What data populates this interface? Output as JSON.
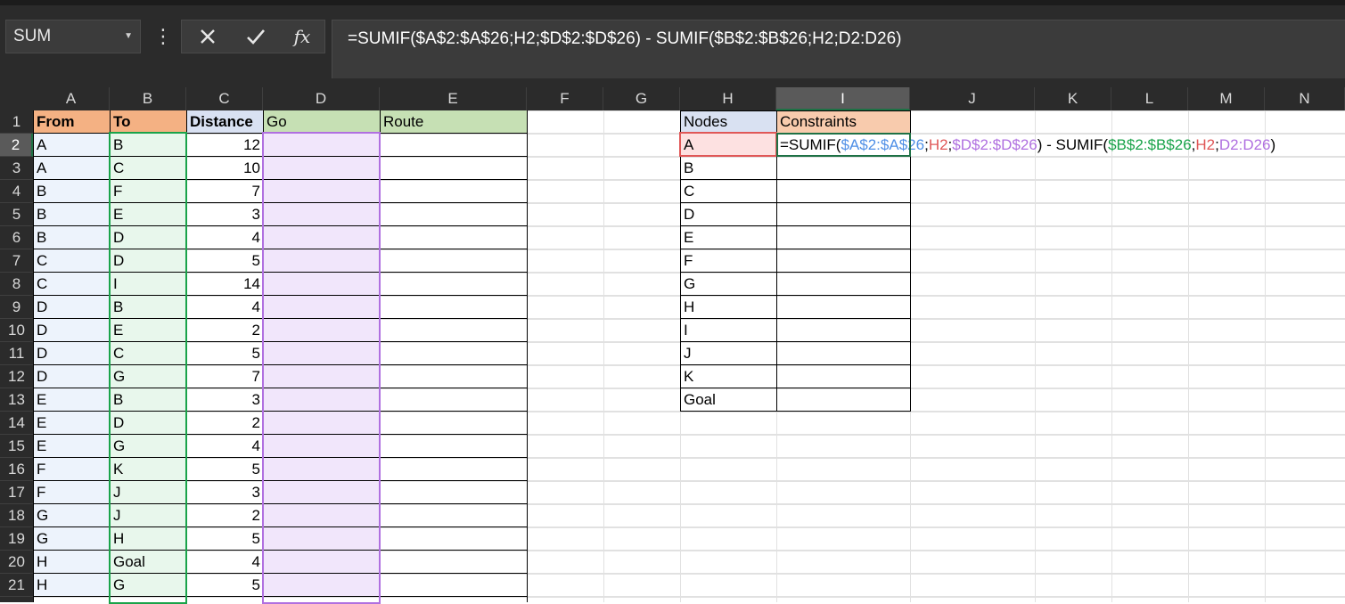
{
  "name_box": {
    "value": "SUM",
    "dropdown_icon": "chevron-down-icon"
  },
  "formula_buttons": {
    "cancel_icon": "cancel-x-icon",
    "enter_icon": "checkmark-icon",
    "fx_label": "fx"
  },
  "formula_bar": {
    "text": "=SUMIF($A$2:$A$26;H2;$D$2:$D$26) - SUMIF($B$2:$B$26;H2;D2:D26)"
  },
  "columns": [
    "A",
    "B",
    "C",
    "D",
    "E",
    "F",
    "G",
    "H",
    "I",
    "J",
    "K",
    "L",
    "M",
    "N"
  ],
  "selected_column": "I",
  "rows": [
    "1",
    "2",
    "3",
    "4",
    "5",
    "6",
    "7",
    "8",
    "9",
    "10",
    "11",
    "12",
    "13",
    "14",
    "15",
    "16",
    "17",
    "18",
    "19",
    "20",
    "21"
  ],
  "selected_row": "2",
  "table_headers": {
    "from": "From",
    "to": "To",
    "distance": "Distance",
    "go": "Go",
    "route": "Route"
  },
  "edges": [
    {
      "from": "A",
      "to": "B",
      "distance": "12"
    },
    {
      "from": "A",
      "to": "C",
      "distance": "10"
    },
    {
      "from": "B",
      "to": "F",
      "distance": "7"
    },
    {
      "from": "B",
      "to": "E",
      "distance": "3"
    },
    {
      "from": "B",
      "to": "D",
      "distance": "4"
    },
    {
      "from": "C",
      "to": "D",
      "distance": "5"
    },
    {
      "from": "C",
      "to": "I",
      "distance": "14"
    },
    {
      "from": "D",
      "to": "B",
      "distance": "4"
    },
    {
      "from": "D",
      "to": "E",
      "distance": "2"
    },
    {
      "from": "D",
      "to": "C",
      "distance": "5"
    },
    {
      "from": "D",
      "to": "G",
      "distance": "7"
    },
    {
      "from": "E",
      "to": "B",
      "distance": "3"
    },
    {
      "from": "E",
      "to": "D",
      "distance": "2"
    },
    {
      "from": "E",
      "to": "G",
      "distance": "4"
    },
    {
      "from": "F",
      "to": "K",
      "distance": "5"
    },
    {
      "from": "F",
      "to": "J",
      "distance": "3"
    },
    {
      "from": "G",
      "to": "J",
      "distance": "2"
    },
    {
      "from": "G",
      "to": "H",
      "distance": "5"
    },
    {
      "from": "H",
      "to": "Goal",
      "distance": "4"
    },
    {
      "from": "H",
      "to": "G",
      "distance": "5"
    }
  ],
  "nodes_table": {
    "nodes_header": "Nodes",
    "constraints_header": "Constraints",
    "nodes": [
      "A",
      "B",
      "C",
      "D",
      "E",
      "F",
      "G",
      "H",
      "I",
      "J",
      "K",
      "Goal"
    ]
  },
  "editing_cell": {
    "parts": [
      {
        "text": "=SUMIF(",
        "color": "#000000"
      },
      {
        "text": "$A$2:$A$26",
        "color": "#4f8fe6"
      },
      {
        "text": ";",
        "color": "#000000"
      },
      {
        "text": "H2",
        "color": "#e05757"
      },
      {
        "text": ";",
        "color": "#000000"
      },
      {
        "text": "$D$2:$D$26",
        "color": "#b070e0"
      },
      {
        "text": ") - SUMIF(",
        "color": "#000000"
      },
      {
        "text": "$B$2:$B$26",
        "color": "#1aa34a"
      },
      {
        "text": ";",
        "color": "#000000"
      },
      {
        "text": "H2",
        "color": "#e05757"
      },
      {
        "text": ";",
        "color": "#000000"
      },
      {
        "text": "D2:D26",
        "color": "#b070e0"
      },
      {
        "text": ")",
        "color": "#000000"
      }
    ]
  },
  "colors": {
    "header_orange": "#f4b183",
    "header_blue": "#d9e1f2",
    "header_green": "#c6e0b4",
    "header_peach": "#f8cbad",
    "ref_blue": "#4f8fe6",
    "ref_red": "#e05757",
    "ref_purple": "#b070e0",
    "ref_green": "#1aa34a"
  }
}
